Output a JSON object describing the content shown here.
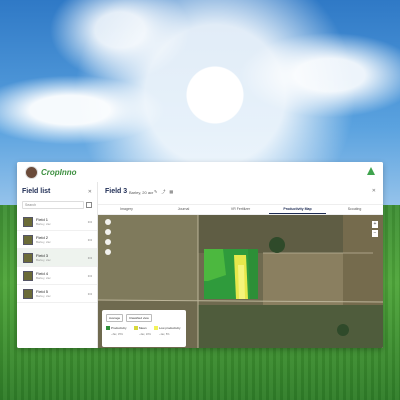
{
  "app": {
    "brand": "CropInno",
    "colors": {
      "accent": "#3fa34d",
      "title": "#1d2b53"
    }
  },
  "sidebar": {
    "title": "Field list",
    "search_placeholder": "Search",
    "items": [
      {
        "name": "Field 1",
        "sub": "Barley, 2ac"
      },
      {
        "name": "Field 2",
        "sub": "Barley, 2ac"
      },
      {
        "name": "Field 3",
        "sub": "Barley, 2ac"
      },
      {
        "name": "Field 4",
        "sub": "Barley, 2ac"
      },
      {
        "name": "Field 5",
        "sub": "Barley, 2ac"
      }
    ],
    "add_label": "+"
  },
  "main": {
    "title": "Field 3",
    "subtitle": "Barley, 20 acr",
    "tabs": [
      "Imagery",
      "Journal",
      "VR Fertilizer",
      "Productivity Map",
      "Scouting"
    ],
    "active_tab": "Productivity Map",
    "pills": [
      "Average",
      "Classified view"
    ],
    "legend": [
      {
        "label": "Productivity",
        "color": "#2f8f3a",
        "note": "~3ac, 15%"
      },
      {
        "label": "Mean",
        "color": "#d8d83a",
        "note": "~4ac, 20%"
      },
      {
        "label": "Low productivity",
        "color": "#f2f25a",
        "note": "~1ac, 5%"
      }
    ],
    "zoom_in": "+",
    "zoom_out": "−"
  },
  "icons": [
    "tree-icon",
    "close-icon",
    "filter-icon",
    "more-icon",
    "pencil-icon",
    "share-icon"
  ]
}
